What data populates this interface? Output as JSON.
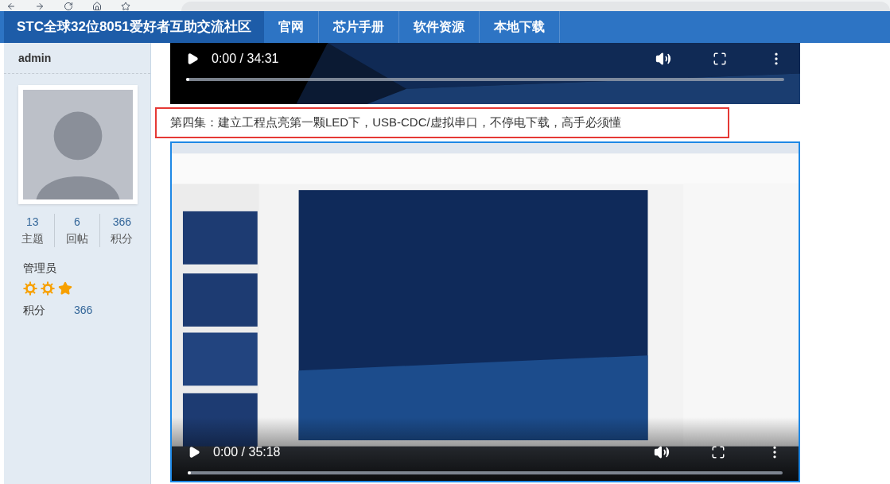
{
  "nav": {
    "brand": "STC全球32位8051爱好者互助交流社区",
    "links": [
      {
        "label": "官网"
      },
      {
        "label": "芯片手册"
      },
      {
        "label": "软件资源"
      },
      {
        "label": "本地下载"
      }
    ]
  },
  "sidebar": {
    "username": "admin",
    "stats": [
      {
        "value": "13",
        "label": "主题"
      },
      {
        "value": "6",
        "label": "回帖"
      },
      {
        "value": "366",
        "label": "积分"
      }
    ],
    "group": "管理员",
    "rank_icons": [
      {
        "kind": "sun"
      },
      {
        "kind": "sun"
      },
      {
        "kind": "star"
      }
    ],
    "points_label": "积分",
    "points_value": "366"
  },
  "videos": [
    {
      "time": "0:00 / 34:31",
      "level": 0
    },
    {
      "caption": "第四集：建立工程点亮第一颗LED下，USB-CDC/虚拟串口，不停电下载，高手必须懂",
      "highlighted": true,
      "time": "0:00 / 35:18",
      "level": 0
    }
  ]
}
